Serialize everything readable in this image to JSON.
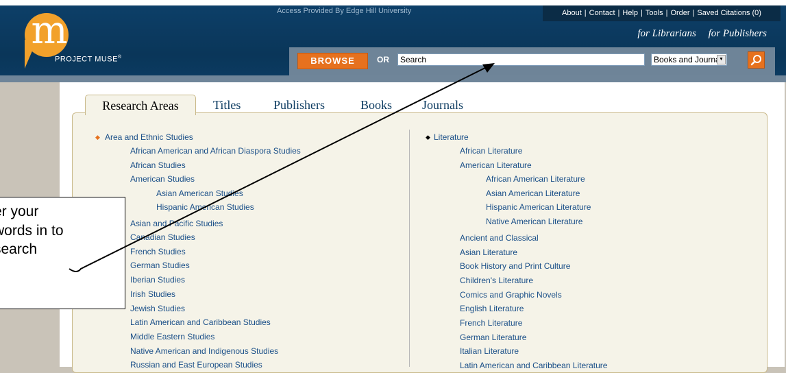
{
  "header": {
    "access_text": "Access Provided By Edge Hill University",
    "logo_letter": "m",
    "brand": "PROJECT MUSE",
    "brand_mark": "®",
    "utility_links": [
      "About",
      "Contact",
      "Help",
      "Tools",
      "Order",
      "Saved Citations (0)"
    ],
    "role_links": [
      "for Librarians",
      "for Publishers"
    ]
  },
  "search": {
    "browse_label": "BROWSE",
    "or_label": "OR",
    "input_value": "Search",
    "scope_selected": "Books and Journals",
    "search_icon": "magnifier-icon"
  },
  "tabs": [
    "Research Areas",
    "Titles",
    "Publishers",
    "Books",
    "Journals"
  ],
  "active_tab": "Research Areas",
  "left_column": {
    "heading": "Area and Ethnic Studies",
    "items": [
      "African American and African Diaspora Studies",
      "African Studies",
      "American Studies",
      "Asian American Studies",
      "Hispanic American Studies",
      "Asian and Pacific Studies",
      "Canadian Studies",
      "French Studies",
      "German Studies",
      "Iberian Studies",
      "Irish Studies",
      "Jewish Studies",
      "Latin American and Caribbean Studies",
      "Middle Eastern Studies",
      "Native American and Indigenous Studies",
      "Russian and East European Studies"
    ]
  },
  "right_column": {
    "heading": "Literature",
    "items": [
      "African Literature",
      "American Literature",
      "African American Literature",
      "Asian American Literature",
      "Hispanic American Literature",
      "Native American Literature",
      "Ancient and Classical",
      "Asian Literature",
      "Book History and Print Culture",
      "Children's Literature",
      "Comics and Graphic Novels",
      "English Literature",
      "French Literature",
      "German Literature",
      "Italian Literature",
      "Latin American and Caribbean Literature"
    ]
  },
  "callout": {
    "lines": [
      "er your",
      "words in to",
      "search",
      "."
    ]
  },
  "colors": {
    "header_bg": "#0b3a60",
    "accent_orange": "#e6711e",
    "link_blue": "#1a4f88",
    "panel_bg": "#f5f3e8"
  }
}
